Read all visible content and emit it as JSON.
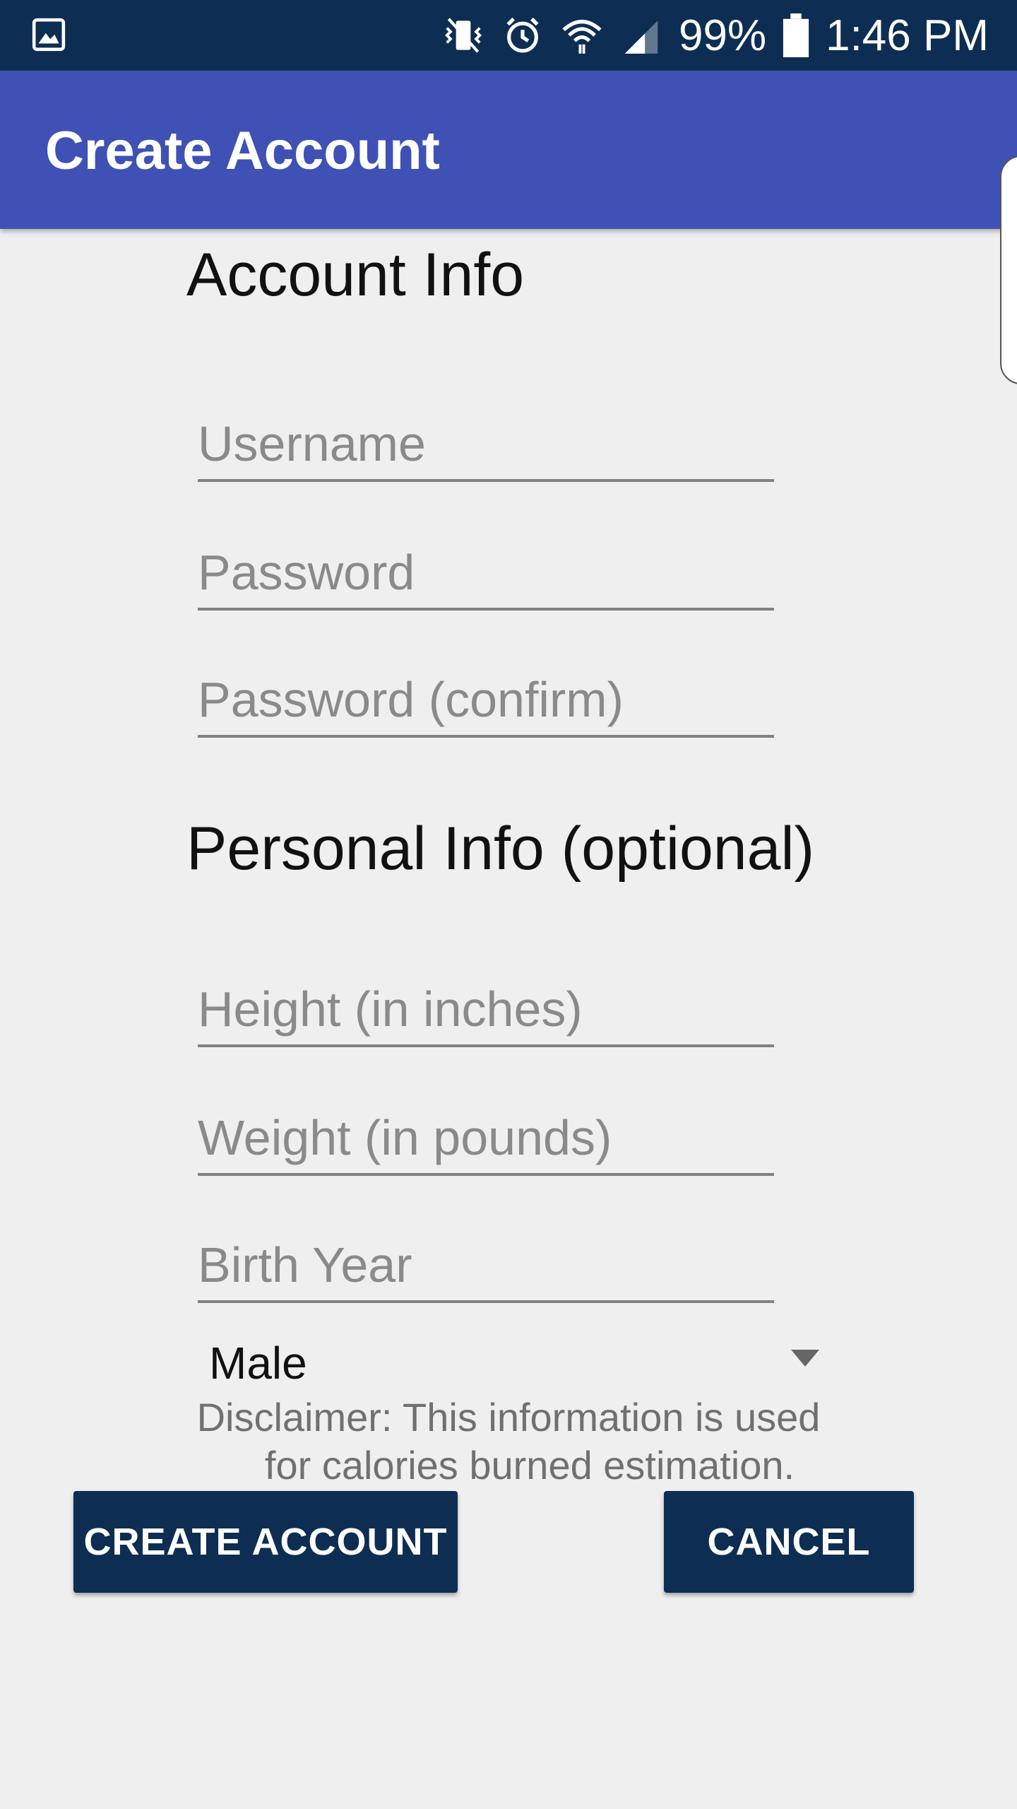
{
  "status_bar": {
    "battery": "99%",
    "time": "1:46 PM",
    "icons": [
      "gallery-icon",
      "vibrate-icon",
      "alarm-icon",
      "wifi-icon",
      "signal-icon",
      "battery-icon"
    ]
  },
  "app_bar": {
    "title": "Create Account"
  },
  "account_section": {
    "title": "Account Info",
    "fields": [
      {
        "placeholder": "Username",
        "value": ""
      },
      {
        "placeholder": "Password",
        "value": ""
      },
      {
        "placeholder": "Password (confirm)",
        "value": ""
      }
    ]
  },
  "personal_section": {
    "title": "Personal Info (optional)",
    "fields": [
      {
        "placeholder": "Height (in inches)",
        "value": ""
      },
      {
        "placeholder": "Weight (in pounds)",
        "value": ""
      },
      {
        "placeholder": "Birth Year",
        "value": ""
      }
    ],
    "gender_selected": "Male"
  },
  "disclaimer": {
    "line1": "Disclaimer: This information is used",
    "line2": "for calories burned estimation."
  },
  "buttons": {
    "create": "CREATE ACCOUNT",
    "cancel": "CANCEL"
  },
  "colors": {
    "status_bar": "#0d2e52",
    "app_bar": "#3f51b5",
    "button": "#0d2e52",
    "background": "#efefef"
  }
}
